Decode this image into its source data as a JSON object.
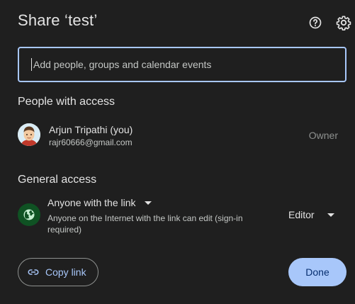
{
  "dialog": {
    "title": "Share ‘test’",
    "help_icon": "help-circle-icon",
    "settings_icon": "gear-icon"
  },
  "search": {
    "placeholder": "Add people, groups and calendar events",
    "value": ""
  },
  "people_with_access": {
    "heading": "People with access",
    "people": [
      {
        "name": "Arjun Tripathi (you)",
        "email": "rajr60666@gmail.com",
        "role": "Owner",
        "avatar_icon": "user-avatar"
      }
    ]
  },
  "general_access": {
    "heading": "General access",
    "access_level": "Anyone with the link",
    "description": "Anyone on the Internet with the link can edit (sign-in required)",
    "role": "Editor",
    "icon": "globe-icon"
  },
  "footer": {
    "copy_link_label": "Copy link",
    "copy_link_icon": "link-icon",
    "done_label": "Done"
  },
  "colors": {
    "background": "#1f1f1f",
    "accent": "#a8c7fa",
    "globe_bg": "#0f5223",
    "text_primary": "#e3e3e3",
    "text_secondary": "#c4c7c5",
    "text_disabled": "#8e918f"
  }
}
